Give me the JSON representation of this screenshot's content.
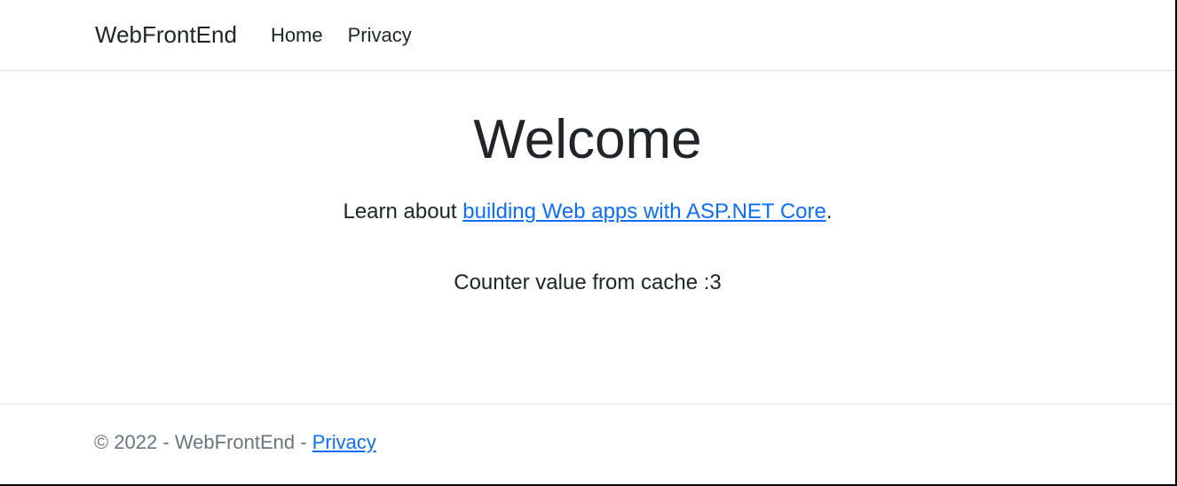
{
  "navbar": {
    "brand": "WebFrontEnd",
    "links": [
      {
        "label": "Home"
      },
      {
        "label": "Privacy"
      }
    ]
  },
  "main": {
    "heading": "Welcome",
    "learn_prefix": "Learn about ",
    "learn_link_text": "building Web apps with ASP.NET Core",
    "learn_suffix": ".",
    "counter_prefix": "Counter value from cache :",
    "counter_value": "3"
  },
  "footer": {
    "copyright_prefix": "© 2022 - WebFrontEnd - ",
    "privacy_label": "Privacy"
  }
}
